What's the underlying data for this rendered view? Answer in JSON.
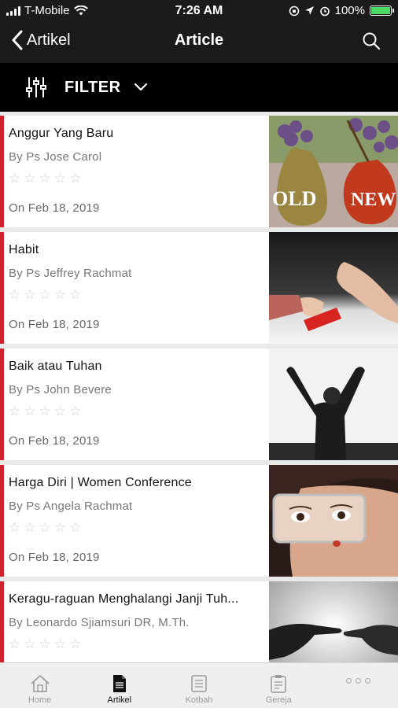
{
  "status_bar": {
    "carrier": "T-Mobile",
    "time": "7:26 AM",
    "battery": "100%"
  },
  "nav": {
    "back_label": "Artikel",
    "title": "Article"
  },
  "filter": {
    "label": "FILTER"
  },
  "articles": [
    {
      "title": "Anggur Yang Baru",
      "author": "By Ps Jose Carol",
      "date": "On Feb 18, 2019",
      "rating": 0,
      "image_text_left": "OLD",
      "image_text_right": "NEW"
    },
    {
      "title": "Habit",
      "author": "By Ps Jeffrey Rachmat",
      "date": "On Feb 18, 2019",
      "rating": 0
    },
    {
      "title": "Baik atau Tuhan",
      "author": "By Ps John Bevere",
      "date": "On Feb 18, 2019",
      "rating": 0
    },
    {
      "title": "Harga Diri | Women Conference",
      "author": "By Ps Angela Rachmat",
      "date": "On Feb 18, 2019",
      "rating": 0
    },
    {
      "title": "Keragu-raguan Menghalangi Janji Tuh...",
      "author": "By Leonardo Sjiamsuri DR, M.Th.",
      "date": "",
      "rating": 0
    }
  ],
  "tabs": [
    {
      "label": "Home",
      "icon": "home-icon",
      "active": false
    },
    {
      "label": "Artikel",
      "icon": "document-icon",
      "active": true
    },
    {
      "label": "Kotbah",
      "icon": "notes-icon",
      "active": false
    },
    {
      "label": "Gereja",
      "icon": "clipboard-icon",
      "active": false
    }
  ],
  "colors": {
    "accent": "#d2222d",
    "header": "#1b1b1b",
    "filter_bar": "#000000",
    "battery": "#4cd964"
  }
}
